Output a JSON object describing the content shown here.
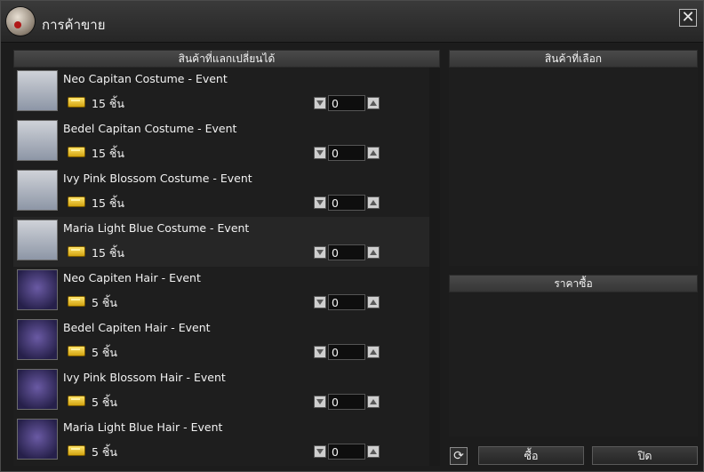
{
  "window": {
    "title": "การค้าขาย",
    "close_symbol": "✕"
  },
  "left_panel": {
    "header": "สินค้าที่แลกเปลี่ยนได้",
    "items": [
      {
        "name": "Neo Capitan Costume - Event",
        "qty": "15 ชิ้น",
        "value": "0",
        "type": "costume"
      },
      {
        "name": "Bedel Capitan Costume - Event",
        "qty": "15 ชิ้น",
        "value": "0",
        "type": "costume"
      },
      {
        "name": "Ivy Pink Blossom Costume - Event",
        "qty": "15 ชิ้น",
        "value": "0",
        "type": "costume"
      },
      {
        "name": "Maria Light Blue Costume - Event",
        "qty": "15 ชิ้น",
        "value": "0",
        "type": "costume"
      },
      {
        "name": "Neo Capiten Hair - Event",
        "qty": "5 ชิ้น",
        "value": "0",
        "type": "hair"
      },
      {
        "name": "Bedel Capiten Hair - Event",
        "qty": "5 ชิ้น",
        "value": "0",
        "type": "hair"
      },
      {
        "name": "Ivy Pink Blossom Hair - Event",
        "qty": "5 ชิ้น",
        "value": "0",
        "type": "hair"
      },
      {
        "name": "Maria Light Blue Hair - Event",
        "qty": "5 ชิ้น",
        "value": "0",
        "type": "hair"
      }
    ]
  },
  "right_panel": {
    "selected_header": "สินค้าที่เลือก",
    "price_header": "ราคาซื้อ",
    "refresh_symbol": "⟳",
    "buy_label": "ซื้อ",
    "close_label": "ปิด"
  },
  "icons": [
    "app-icon",
    "close-icon",
    "coin-icon",
    "arrow-down-icon",
    "arrow-up-icon",
    "refresh-icon"
  ]
}
